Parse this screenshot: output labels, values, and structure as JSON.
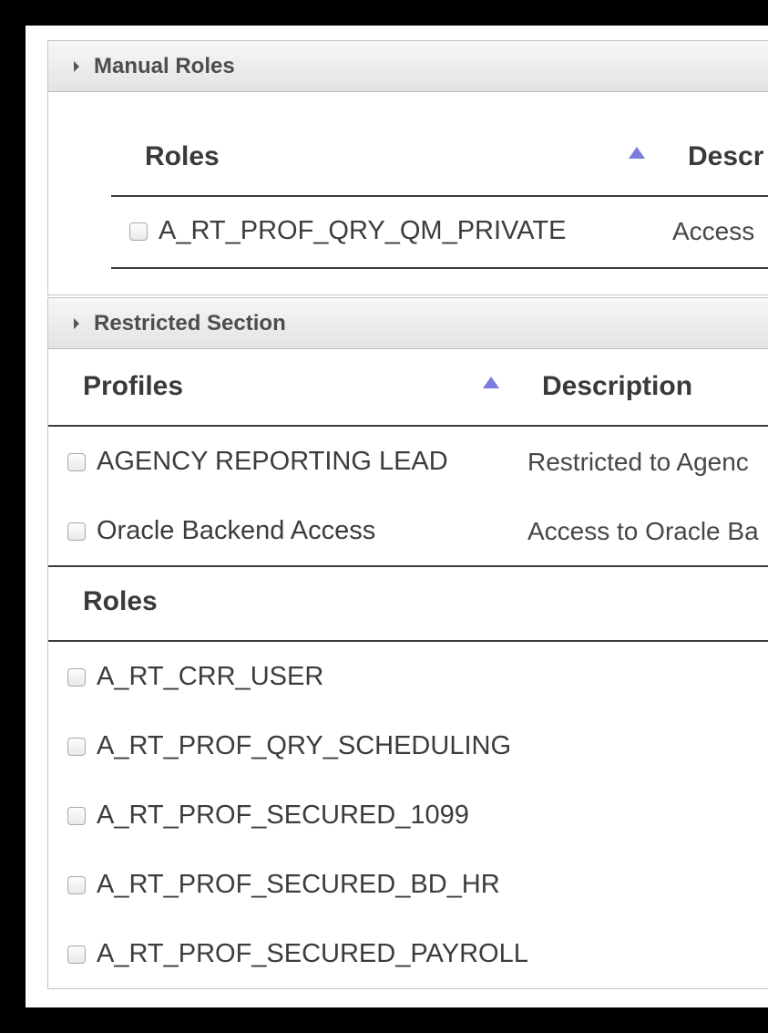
{
  "manual_roles": {
    "title": "Manual Roles",
    "columns": {
      "roles": "Roles",
      "description": "Descr"
    },
    "rows": [
      {
        "role": "A_RT_PROF_QRY_QM_PRIVATE",
        "description": "Access"
      }
    ]
  },
  "restricted_section": {
    "title": "Restricted Section",
    "profiles_table": {
      "columns": {
        "profiles": "Profiles",
        "description": "Description"
      },
      "rows": [
        {
          "profile": "AGENCY REPORTING LEAD",
          "description": "Restricted to Agenc"
        },
        {
          "profile": "Oracle Backend Access",
          "description": "Access to Oracle Ba"
        }
      ]
    },
    "roles_table": {
      "columns": {
        "roles": "Roles"
      },
      "rows": [
        {
          "role": "A_RT_CRR_USER"
        },
        {
          "role": "A_RT_PROF_QRY_SCHEDULING"
        },
        {
          "role": "A_RT_PROF_SECURED_1099"
        },
        {
          "role": "A_RT_PROF_SECURED_BD_HR"
        },
        {
          "role": "A_RT_PROF_SECURED_PAYROLL"
        }
      ]
    }
  },
  "colors": {
    "sort_arrow": "#7b7bdc",
    "header_gradient_top": "#f7f7f7",
    "header_gradient_bottom": "#e3e3e3"
  }
}
